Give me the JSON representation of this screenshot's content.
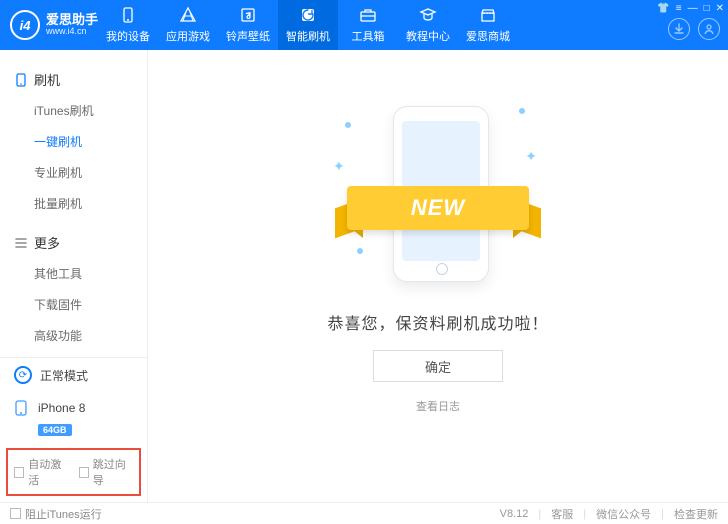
{
  "brand": {
    "name": "爱思助手",
    "url": "www.i4.cn",
    "logo_letters": "i4"
  },
  "nav": [
    {
      "key": "device",
      "label": "我的设备"
    },
    {
      "key": "apps",
      "label": "应用游戏"
    },
    {
      "key": "ringtone",
      "label": "铃声壁纸"
    },
    {
      "key": "flash",
      "label": "智能刷机"
    },
    {
      "key": "toolbox",
      "label": "工具箱"
    },
    {
      "key": "tutorial",
      "label": "教程中心"
    },
    {
      "key": "store",
      "label": "爱思商城"
    }
  ],
  "nav_active": "flash",
  "sidebar": {
    "groups": [
      {
        "title": "刷机",
        "icon": "phone",
        "items": [
          "iTunes刷机",
          "一键刷机",
          "专业刷机",
          "批量刷机"
        ],
        "active": "一键刷机"
      },
      {
        "title": "更多",
        "icon": "menu",
        "items": [
          "其他工具",
          "下载固件",
          "高级功能"
        ]
      }
    ],
    "mode": {
      "label": "正常模式"
    },
    "device": {
      "name": "iPhone 8",
      "storage": "64GB"
    }
  },
  "options": {
    "auto_activate": "自动激活",
    "skip_guide": "跳过向导"
  },
  "main": {
    "ribbon": "NEW",
    "message": "恭喜您，保资料刷机成功啦！",
    "button": "确定",
    "log_link": "查看日志"
  },
  "status": {
    "block_itunes": "阻止iTunes运行",
    "version": "V8.12",
    "links": [
      "客服",
      "微信公众号",
      "检查更新"
    ]
  }
}
